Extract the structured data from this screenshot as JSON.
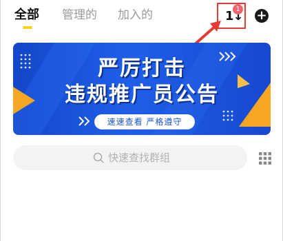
{
  "header": {
    "tabs": [
      {
        "label": "全部",
        "active": true
      },
      {
        "label": "管理的",
        "active": false
      },
      {
        "label": "加入的",
        "active": false
      }
    ],
    "sort_icon": "sort-icon",
    "sort_badge": "1",
    "add_icon": "plus-circle-icon"
  },
  "banner": {
    "line1": "严厉打击",
    "line2": "违规推广员公告",
    "pill": "速速查看 严格遵守"
  },
  "search": {
    "placeholder": "快速查找群组",
    "icon": "search-icon"
  },
  "grid_icon": "grid-icon",
  "colors": {
    "accent": "#ffd21f",
    "highlight": "#e53935",
    "badge": "#f0656d",
    "banner_blue": "#1f5fe8",
    "banner_orange": "#f5a623"
  }
}
